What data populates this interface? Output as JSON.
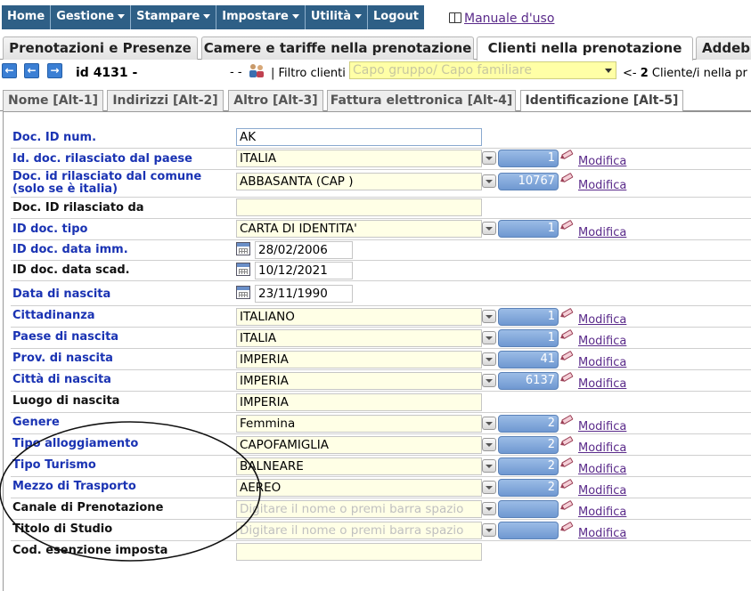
{
  "menu": [
    {
      "label": "Home",
      "caret": false
    },
    {
      "label": "Gestione",
      "caret": true
    },
    {
      "label": "Stampare",
      "caret": true
    },
    {
      "label": "Impostare",
      "caret": true
    },
    {
      "label": "Utilità",
      "caret": true
    },
    {
      "label": "Logout",
      "caret": false
    }
  ],
  "manual_label": "Manuale d'uso",
  "main_tabs": [
    "Prenotazioni e Presenze",
    "Camere e tariffe nella prenotazione",
    "Clienti nella prenotazione",
    "Addebi"
  ],
  "nav": {
    "id_label": "id 4131 -",
    "dashes": "- -",
    "filter_label": "| Filtro clienti",
    "filter_value": "Capo gruppo/ Capo familiare",
    "client_count_prefix": "<-",
    "client_count_number": "2",
    "client_count_suffix": "Cliente/i nella pr"
  },
  "sub_tabs": [
    "Nome [Alt-1]",
    "Indirizzi [Alt-2]",
    "Altro [Alt-3]",
    "Fattura elettronica [Alt-4]",
    "Identificazione [Alt-5]"
  ],
  "modifica_label": "Modifica",
  "fields": {
    "doc_id_num": {
      "label": "Doc. ID num.",
      "value": "AK"
    },
    "doc_paese": {
      "label": "Id. doc. rilasciato dal paese",
      "value": "ITALIA",
      "code": "1"
    },
    "doc_comune": {
      "label1": "Doc. id rilasciato dal comune",
      "label2": "(solo se è italia)",
      "value": "ABBASANTA  (CAP )",
      "code": "10767"
    },
    "doc_rilasciato_da": {
      "label": "Doc. ID rilasciato da",
      "value": ""
    },
    "doc_tipo": {
      "label": "ID doc. tipo",
      "value": "CARTA DI IDENTITA'",
      "code": "1"
    },
    "doc_data_imm": {
      "label": "ID doc. data imm.",
      "value": "28/02/2006"
    },
    "doc_data_scad": {
      "label": "ID doc. data scad.",
      "value": "10/12/2021"
    },
    "data_nascita": {
      "label": "Data di nascita",
      "value": "23/11/1990"
    },
    "cittadinanza": {
      "label": "Cittadinanza",
      "value": "ITALIANO",
      "code": "1"
    },
    "paese_nascita": {
      "label": "Paese di nascita",
      "value": "ITALIA",
      "code": "1"
    },
    "prov_nascita": {
      "label": "Prov. di nascita",
      "value": "IMPERIA",
      "code": "41"
    },
    "citta_nascita": {
      "label": "Città di nascita",
      "value": "IMPERIA",
      "code": "6137"
    },
    "luogo_nascita": {
      "label": "Luogo di nascita",
      "value": "IMPERIA"
    },
    "genere": {
      "label": "Genere",
      "value": "Femmina",
      "code": "2"
    },
    "tipo_alloggiamento": {
      "label": "Tipo alloggiamento",
      "value": "CAPOFAMIGLIA",
      "code": "2"
    },
    "tipo_turismo": {
      "label": "Tipo Turismo",
      "value": "BALNEARE",
      "code": "2"
    },
    "mezzo_trasporto": {
      "label": "Mezzo di Trasporto",
      "value": "AEREO",
      "code": "2"
    },
    "canale_prenotazione": {
      "label": "Canale di Prenotazione",
      "placeholder": "Digitare il nome o premi barra spazio",
      "code": ""
    },
    "titolo_studio": {
      "label": "Titolo di Studio",
      "placeholder": "Digitare il nome o premi barra spazio",
      "code": ""
    },
    "cod_esenzione": {
      "label": "Cod. esenzione imposta",
      "value": ""
    }
  },
  "colors": {
    "menu_bg": "#2e5f86",
    "label_blue": "#1a33b3",
    "input_yellow": "#ffffe6",
    "code_blue": "#7aa1d6",
    "filter_yellow": "#ffffa6"
  }
}
